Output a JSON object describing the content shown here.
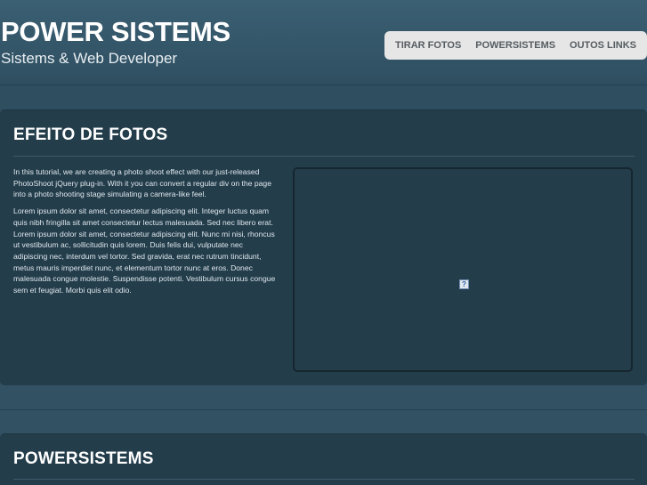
{
  "header": {
    "title": "POWER SISTEMS",
    "tagline": "Sistems & Web Developer"
  },
  "nav": {
    "items": [
      {
        "label": "TIRAR FOTOS"
      },
      {
        "label": "POWERSISTEMS"
      },
      {
        "label": "OUTOS LINKS"
      }
    ]
  },
  "sections": [
    {
      "title": "EFEITO DE FOTOS",
      "paragraphs": [
        "In this tutorial, we are creating a photo shoot effect with our just-released PhotoShoot jQuery plug-in. With it you can convert a regular div on the page into a photo shooting stage simulating a camera-like feel.",
        "Lorem ipsum dolor sit amet, consectetur adipiscing elit. Integer luctus quam quis nibh fringilla sit amet consectetur lectus malesuada. Sed nec libero erat. Lorem ipsum dolor sit amet, consectetur adipiscing elit. Nunc mi nisi, rhoncus ut vestibulum ac, sollicitudin quis lorem. Duis felis dui, vulputate nec adipiscing nec, interdum vel tortor. Sed gravida, erat nec rutrum tincidunt, metus mauris imperdiet nunc, et elementum tortor nunc at eros. Donec malesuada congue molestie. Suspendisse potenti. Vestibulum cursus congue sem et feugiat. Morbi quis elit odio."
      ],
      "photo_icon": "broken-image-icon"
    },
    {
      "title": "POWERSISTEMS"
    }
  ],
  "colors": {
    "background": "#2e4b5c",
    "panel": "#233d4b",
    "nav_bg": "#e6e6e6",
    "nav_text": "#555c61",
    "text": "#ffffff"
  }
}
